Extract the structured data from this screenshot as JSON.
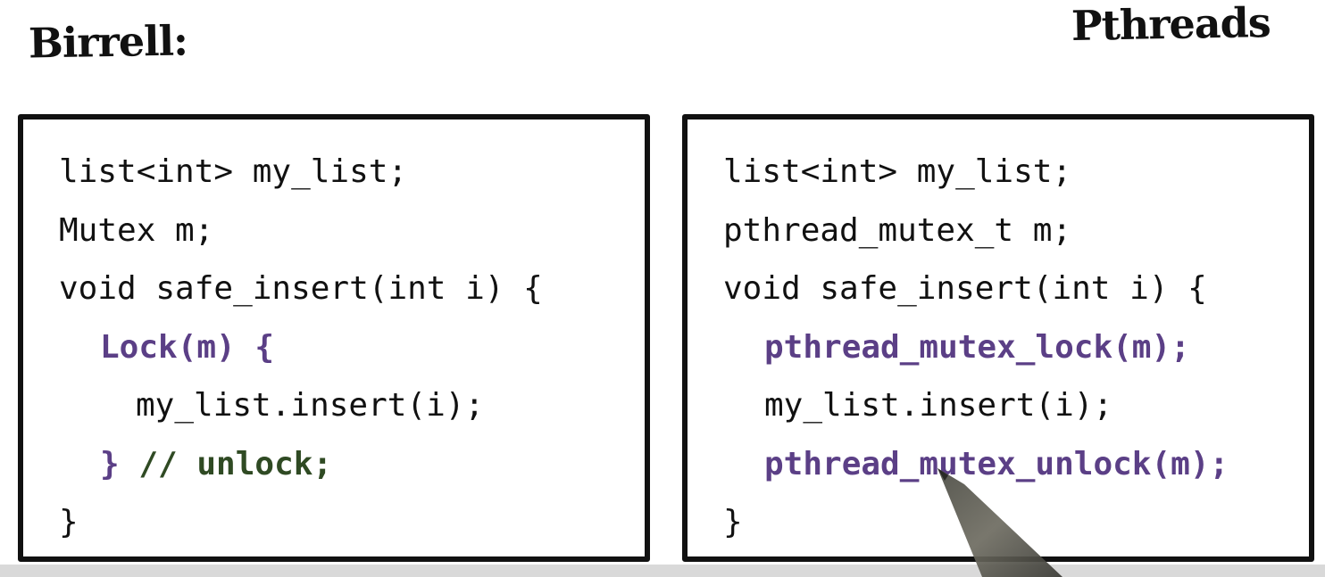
{
  "labels": {
    "left": "Birrell:",
    "right": "Pthreads"
  },
  "colors": {
    "lock_purple": "#5b3f86",
    "comment_green": "#2f4a23",
    "text_dark": "#111111"
  },
  "left_code": {
    "line1": "list<int> my_list;",
    "line2": "Mutex m;",
    "line3": "void safe_insert(int i) {",
    "line4": "Lock(m) {",
    "line5": "my_list.insert(i);",
    "line6_brace": "}",
    "line6_comment": " // unlock;",
    "line7": "}"
  },
  "right_code": {
    "line1": "list<int> my_list;",
    "line2": "pthread_mutex_t m;",
    "line3": "void safe_insert(int i) {",
    "line4": "pthread_mutex_lock(m);",
    "line5": "my_list.insert(i);",
    "line6": "pthread_mutex_unlock(m);",
    "line7": "}"
  }
}
